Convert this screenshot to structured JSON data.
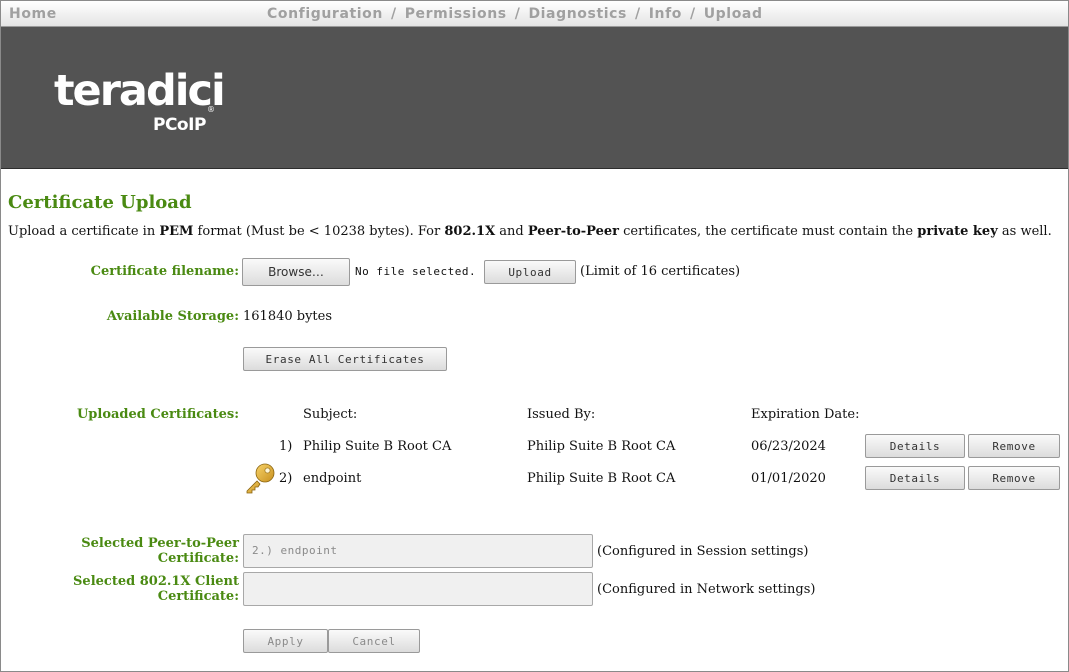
{
  "nav": {
    "home": "Home",
    "separator": "/",
    "items": [
      "Configuration",
      "Permissions",
      "Diagnostics",
      "Info",
      "Upload"
    ]
  },
  "brand": {
    "logo": "teradici",
    "reg": "®",
    "sub": "PCoIP"
  },
  "page": {
    "title": "Certificate Upload",
    "intro": {
      "t1": "Upload a certificate in ",
      "b1": "PEM",
      "t2": " format (Must be < 10238 bytes). For ",
      "b2": "802.1X",
      "t3": " and ",
      "b3": "Peer-to-Peer",
      "t4": " certificates, the certificate must contain the ",
      "b4": "private key",
      "t5": " as well."
    }
  },
  "upload": {
    "label": "Certificate filename:",
    "browse_label": "Browse…",
    "file_status": "No file selected.",
    "upload_label": "Upload",
    "limit_note": "(Limit of 16 certificates)"
  },
  "storage": {
    "label": "Available Storage:",
    "value": "161840 bytes"
  },
  "erase_label": "Erase All Certificates",
  "certs": {
    "label": "Uploaded Certificates:",
    "headers": {
      "subject": "Subject:",
      "issued_by": "Issued By:",
      "expiration": "Expiration Date:"
    },
    "rows": [
      {
        "num": "1)",
        "subject": "Philip Suite B Root CA",
        "issued_by": "Philip Suite B Root CA",
        "expiration": "06/23/2024",
        "has_key": false
      },
      {
        "num": "2)",
        "subject": "endpoint",
        "issued_by": "Philip Suite B Root CA",
        "expiration": "01/01/2020",
        "has_key": true
      }
    ],
    "details_label": "Details",
    "remove_label": "Remove"
  },
  "selected": {
    "p2p_label": [
      "Selected Peer-to-Peer",
      "Certificate:"
    ],
    "p2p_value": "2.) endpoint",
    "p2p_note": "(Configured in Session settings)",
    "dot1x_label": [
      "Selected 802.1X Client",
      "Certificate:"
    ],
    "dot1x_value": "",
    "dot1x_note": "(Configured in Network settings)"
  },
  "actions": {
    "apply": "Apply",
    "cancel": "Cancel"
  },
  "colors": {
    "label_green": "#4a8a12",
    "banner": "#535353",
    "nav_text": "#a0a0a0"
  }
}
